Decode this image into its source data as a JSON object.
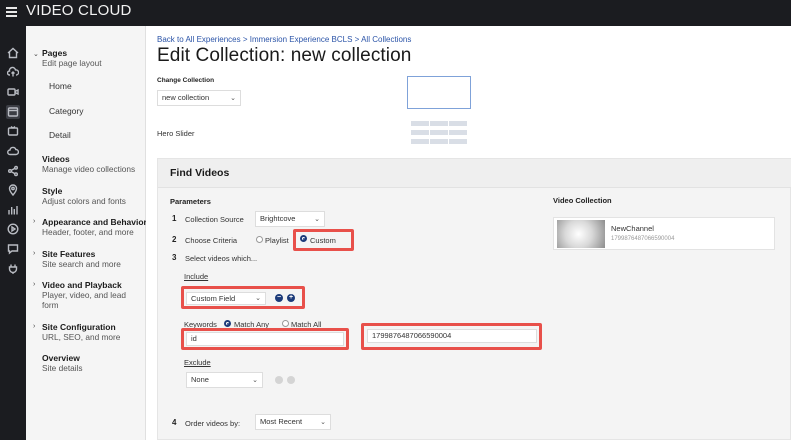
{
  "app": {
    "title": "VIDEO CLOUD"
  },
  "rail_icons": [
    "home-icon",
    "upload-icon",
    "video-icon",
    "experiences-icon",
    "tv-icon",
    "cloud-icon",
    "share-icon",
    "location-icon",
    "analytics-icon",
    "play-icon",
    "chat-icon",
    "plugin-icon"
  ],
  "sidebar": {
    "pages": {
      "title": "Pages",
      "sub": "Edit page layout",
      "children": [
        "Home",
        "Category",
        "Detail"
      ]
    },
    "videos": {
      "title": "Videos",
      "sub": "Manage video collections"
    },
    "style": {
      "title": "Style",
      "sub": "Adjust colors and fonts"
    },
    "appearance": {
      "title": "Appearance and Behavior",
      "sub": "Header, footer, and more"
    },
    "site_features": {
      "title": "Site Features",
      "sub": "Site search and more"
    },
    "video_playback": {
      "title": "Video and Playback",
      "sub1": "Player, video, and lead",
      "sub2": "form"
    },
    "site_config": {
      "title": "Site Configuration",
      "sub": "URL, SEO, and more"
    },
    "overview": {
      "title": "Overview",
      "sub": "Site details"
    }
  },
  "main": {
    "breadcrumb": "Back to All Experiences > Immersion Experience BCLS > All Collections",
    "title": "Edit Collection: new collection",
    "change_collection_label": "Change Collection",
    "change_collection_value": "new collection",
    "hero_label": "Hero Slider"
  },
  "find": {
    "title": "Find Videos",
    "parameters_label": "Parameters",
    "step1_num": "1",
    "step1_label": "Collection Source",
    "step1_value": "Brightcove",
    "step2_num": "2",
    "step2_label": "Choose Criteria",
    "opt_playlist": "Playlist",
    "opt_custom": "Custom",
    "step3_num": "3",
    "step3_label": "Select videos which...",
    "include_label": "Include",
    "include_field": "Custom Field",
    "keywords_label": "Keywords",
    "match_any": "Match Any",
    "match_all": "Match All",
    "field_name_value": "id",
    "field_value": "1799876487066590004",
    "exclude_label": "Exclude",
    "exclude_value": "None",
    "step4_num": "4",
    "step4_label": "Order videos by:",
    "order_value": "Most Recent"
  },
  "collection": {
    "title": "Video Collection",
    "video_name": "NewChannel",
    "video_id": "1799876487066590004"
  },
  "colors": {
    "highlight": "#e8504a",
    "accent": "#1d3b7a",
    "link": "#2b54a8"
  }
}
